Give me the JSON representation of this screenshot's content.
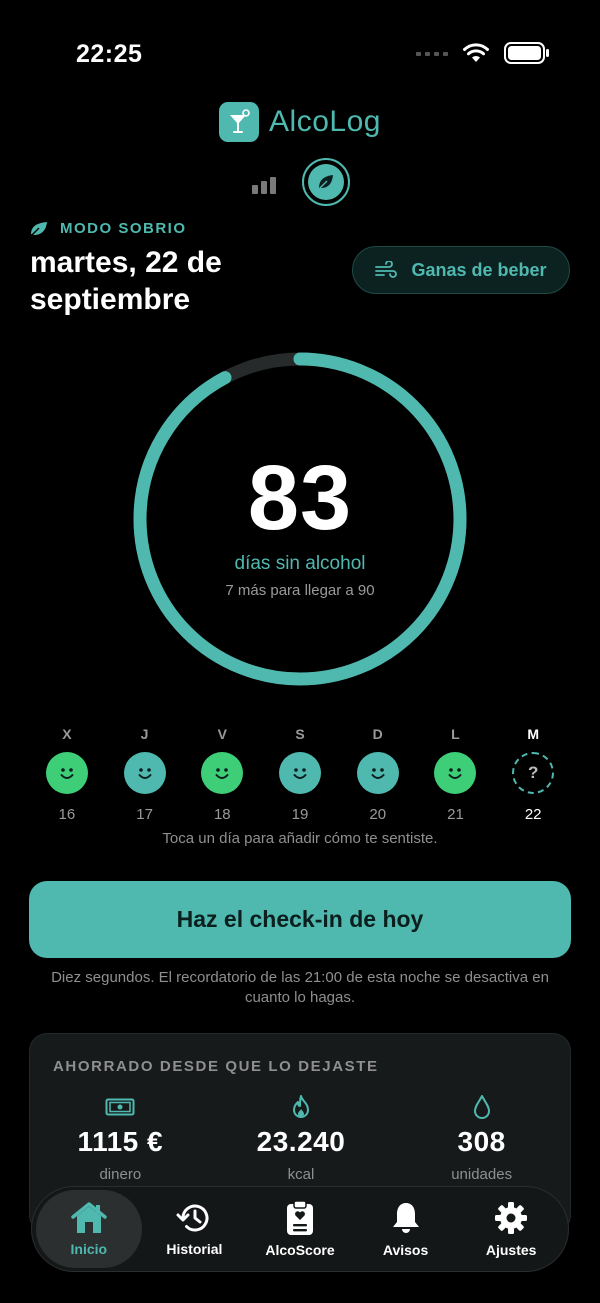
{
  "status_bar": {
    "time": "22:25"
  },
  "app": {
    "name": "AlcoLog"
  },
  "mode": {
    "label": "MODO SOBRIO"
  },
  "date": {
    "title": "martes, 22 de septiembre"
  },
  "craving_button": {
    "label": "Ganas de beber"
  },
  "streak": {
    "days": "83",
    "label": "días sin alcohol",
    "subtitle": "7 más para llegar a 90",
    "progress_fraction": 0.922,
    "goal_days": 90
  },
  "week": [
    {
      "letter": "X",
      "number": "16",
      "mood": "happy",
      "color": "#3fce78"
    },
    {
      "letter": "J",
      "number": "17",
      "mood": "happy",
      "color": "#4fb9b0"
    },
    {
      "letter": "V",
      "number": "18",
      "mood": "happy",
      "color": "#3fce78"
    },
    {
      "letter": "S",
      "number": "19",
      "mood": "happy",
      "color": "#4fb9b0"
    },
    {
      "letter": "D",
      "number": "20",
      "mood": "happy",
      "color": "#4fb9b0"
    },
    {
      "letter": "L",
      "number": "21",
      "mood": "happy",
      "color": "#3fce78"
    },
    {
      "letter": "M",
      "number": "22",
      "mood": "unknown",
      "symbol": "?"
    }
  ],
  "week_hint": "Toca un día para añadir cómo te sentiste.",
  "checkin": {
    "button_label": "Haz el check-in de hoy",
    "note": "Diez segundos. El recordatorio de las 21:00 de esta noche se desactiva en cuanto lo hagas."
  },
  "savings": {
    "title": "AHORRADO DESDE QUE LO DEJASTE",
    "stats": [
      {
        "icon": "cash-icon",
        "value": "1115 €",
        "label": "dinero"
      },
      {
        "icon": "flame-icon",
        "value": "23.240",
        "label": "kcal"
      },
      {
        "icon": "drop-icon",
        "value": "308",
        "label": "unidades"
      }
    ]
  },
  "tabs": [
    {
      "icon": "home-icon",
      "label": "Inicio",
      "active": true
    },
    {
      "icon": "history-icon",
      "label": "Historial"
    },
    {
      "icon": "clipboard-heart-icon",
      "label": "AlcoScore"
    },
    {
      "icon": "bell-icon",
      "label": "Avisos"
    },
    {
      "icon": "gear-icon",
      "label": "Ajustes"
    }
  ],
  "colors": {
    "accent": "#4fb9b0",
    "green": "#3fce78",
    "background": "#000000"
  }
}
